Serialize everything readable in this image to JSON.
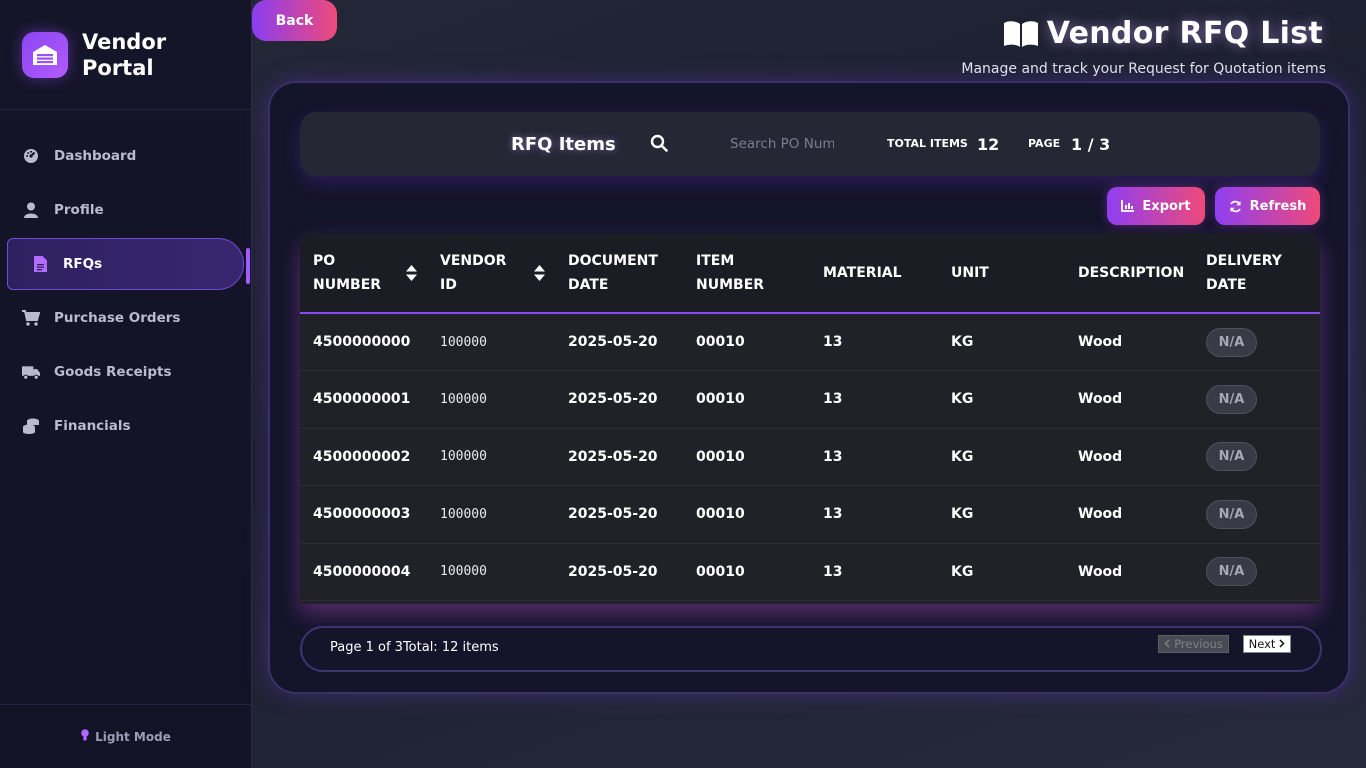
{
  "sidebar": {
    "brand": "Vendor Portal",
    "items": [
      {
        "label": "Dashboard",
        "icon": "dashboard-icon"
      },
      {
        "label": "Profile",
        "icon": "user-icon"
      },
      {
        "label": "RFQs",
        "icon": "document-icon",
        "active": true
      },
      {
        "label": "Purchase Orders",
        "icon": "cart-icon"
      },
      {
        "label": "Goods Receipts",
        "icon": "truck-icon"
      },
      {
        "label": "Financials",
        "icon": "coins-icon"
      }
    ],
    "theme_toggle": "Light Mode"
  },
  "back_label": "Back",
  "header": {
    "title": "Vendor RFQ List",
    "subtitle": "Manage and track your Request for Quotation items"
  },
  "toolbar": {
    "title": "RFQ Items",
    "search_placeholder": "Search PO Number",
    "total_label": "TOTAL ITEMS",
    "total_value": "12",
    "page_label": "PAGE",
    "page_value": "1 / 3",
    "export_label": "Export",
    "refresh_label": "Refresh"
  },
  "table": {
    "columns": [
      "PO NUMBER",
      "VENDOR ID",
      "DOCUMENT DATE",
      "ITEM NUMBER",
      "MATERIAL",
      "UNIT",
      "DESCRIPTION",
      "DELIVERY DATE"
    ],
    "rows": [
      [
        "4500000000",
        "100000",
        "2025-05-20",
        "00010",
        "13",
        "KG",
        "Wood",
        "N/A"
      ],
      [
        "4500000001",
        "100000",
        "2025-05-20",
        "00010",
        "13",
        "KG",
        "Wood",
        "N/A"
      ],
      [
        "4500000002",
        "100000",
        "2025-05-20",
        "00010",
        "13",
        "KG",
        "Wood",
        "N/A"
      ],
      [
        "4500000003",
        "100000",
        "2025-05-20",
        "00010",
        "13",
        "KG",
        "Wood",
        "N/A"
      ],
      [
        "4500000004",
        "100000",
        "2025-05-20",
        "00010",
        "13",
        "KG",
        "Wood",
        "N/A"
      ]
    ]
  },
  "pagination": {
    "info": "Page 1 of 3Total: 12 items",
    "previous": "Previous",
    "next": "Next"
  },
  "colors": {
    "accent": "#8a3df0",
    "accent_pink": "#ee4a7a",
    "background": "#1d2030",
    "sidebar": "#141428"
  }
}
